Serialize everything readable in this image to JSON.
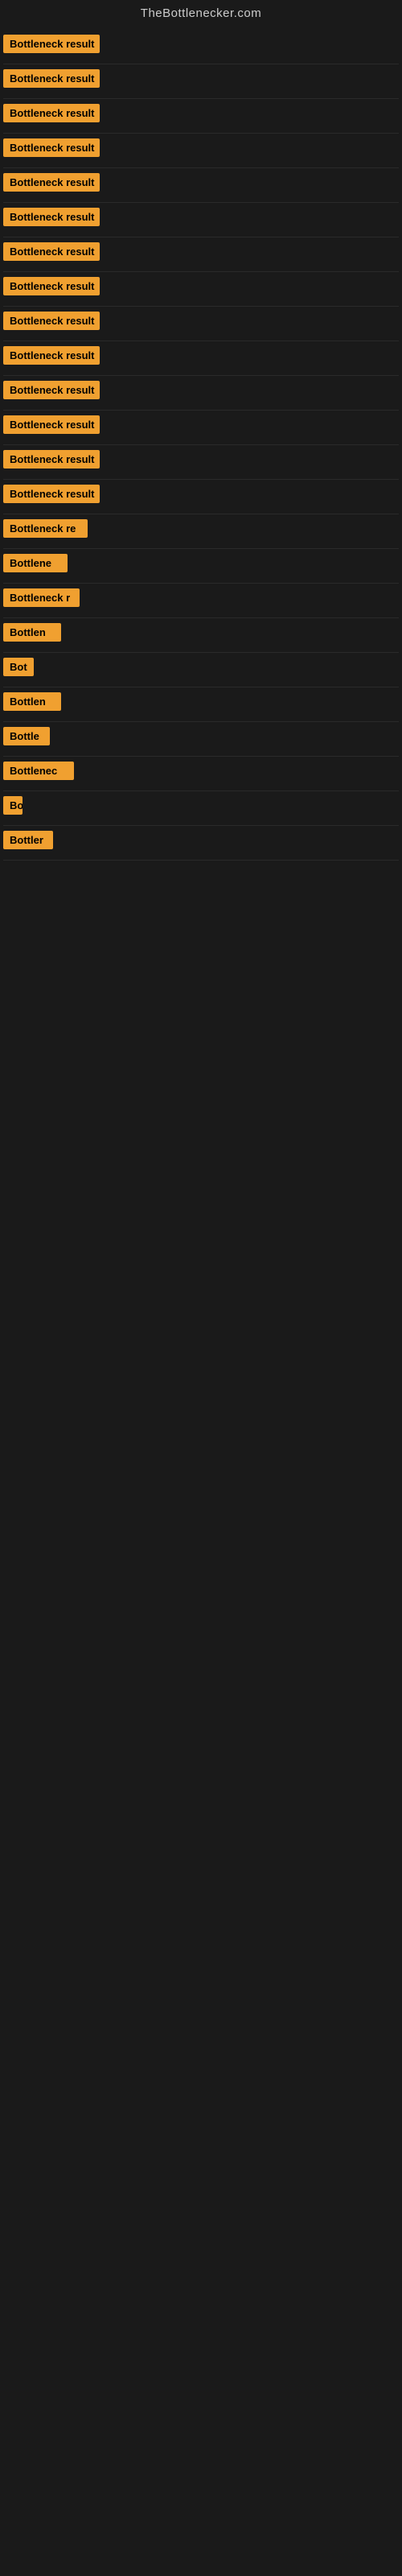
{
  "header": {
    "title": "TheBottlenecker.com"
  },
  "items": [
    {
      "id": 1,
      "label": "Bottleneck result",
      "width": "full"
    },
    {
      "id": 2,
      "label": "Bottleneck result",
      "width": "full"
    },
    {
      "id": 3,
      "label": "Bottleneck result",
      "width": "full"
    },
    {
      "id": 4,
      "label": "Bottleneck result",
      "width": "full"
    },
    {
      "id": 5,
      "label": "Bottleneck result",
      "width": "full"
    },
    {
      "id": 6,
      "label": "Bottleneck result",
      "width": "full"
    },
    {
      "id": 7,
      "label": "Bottleneck result",
      "width": "full"
    },
    {
      "id": 8,
      "label": "Bottleneck result",
      "width": "full"
    },
    {
      "id": 9,
      "label": "Bottleneck result",
      "width": "full"
    },
    {
      "id": 10,
      "label": "Bottleneck result",
      "width": "full"
    },
    {
      "id": 11,
      "label": "Bottleneck result",
      "width": "full"
    },
    {
      "id": 12,
      "label": "Bottleneck result",
      "width": "full"
    },
    {
      "id": 13,
      "label": "Bottleneck result",
      "width": "full"
    },
    {
      "id": 14,
      "label": "Bottleneck result",
      "width": "full"
    },
    {
      "id": 15,
      "label": "Bottleneck re",
      "width": "partial1"
    },
    {
      "id": 16,
      "label": "Bottlene",
      "width": "partial2"
    },
    {
      "id": 17,
      "label": "Bottleneck r",
      "width": "partial3"
    },
    {
      "id": 18,
      "label": "Bottlen",
      "width": "partial4"
    },
    {
      "id": 19,
      "label": "Bot",
      "width": "partial5"
    },
    {
      "id": 20,
      "label": "Bottlen",
      "width": "partial4"
    },
    {
      "id": 21,
      "label": "Bottle",
      "width": "partial6"
    },
    {
      "id": 22,
      "label": "Bottlenec",
      "width": "partial7"
    },
    {
      "id": 23,
      "label": "Bo",
      "width": "partial8"
    },
    {
      "id": 24,
      "label": "Bottler",
      "width": "partial9"
    }
  ],
  "colors": {
    "badge_bg": "#f0a030",
    "badge_text": "#000000",
    "site_header_text": "#cccccc",
    "page_bg": "#1a1a1a"
  }
}
